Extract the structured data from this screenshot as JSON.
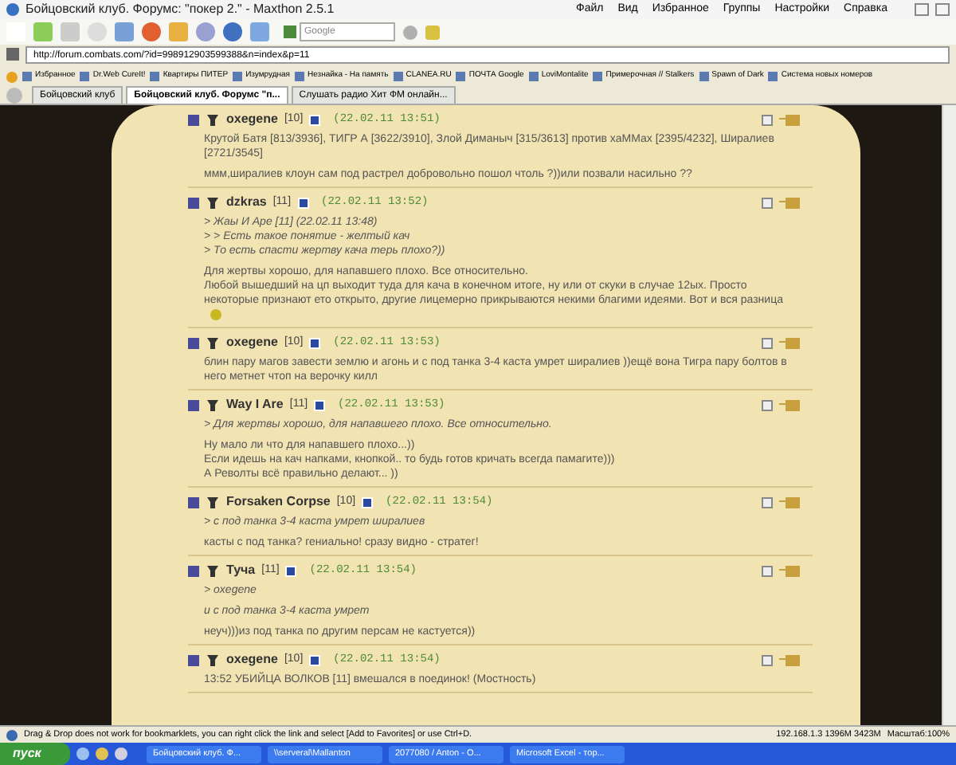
{
  "window": {
    "title": "Бойцовский клуб. Форумс: \"покер 2.\" - Maxthon 2.5.1"
  },
  "menu": [
    "Файл",
    "Вид",
    "Избранное",
    "Группы",
    "Настройки",
    "Справка"
  ],
  "search": {
    "placeholder": "Google"
  },
  "address": {
    "value": "http://forum.combats.com/?id=998912903599388&n=index&p=11"
  },
  "bookmarks": [
    "Избранное",
    "Dr.Web CureIt!",
    "Квартиры ПИТЕР",
    "Изумрудная",
    "Незнайка - На память",
    "CLANEA.RU",
    "ПОЧТА Google",
    "LoviMontalite",
    "Примерочная // Stalkers",
    "Spawn of Dark",
    "Система  новых номеров"
  ],
  "tabs": [
    {
      "label": "Бойцовский клуб",
      "selected": false
    },
    {
      "label": "Бойцовский клуб. Форумс \"п...",
      "selected": true
    },
    {
      "label": "Слушать радио Хит ФМ онлайн...",
      "selected": false
    }
  ],
  "posts": [
    {
      "author": "oxegene",
      "level": "[10]",
      "time": "(22.02.11 13:51)",
      "checked": false,
      "paragraphs": [
        {
          "kind": "text",
          "text": "Крутой Батя [813/3936], ТИГР А [3622/3910], Злой Диманыч [315/3613] против хаММах [2395/4232], Ширалиев [2721/3545]"
        },
        {
          "kind": "text",
          "text": "ммм,ширалиев клоун сам под растрел добровольно пошол чтоль ?))или позвали насильно ??"
        }
      ]
    },
    {
      "author": "dzkras",
      "level": "[11]",
      "time": "(22.02.11 13:52)",
      "checked": false,
      "paragraphs": [
        {
          "kind": "quote",
          "text": "> Жаы И Аре [11] (22.02.11 13:48)\n> > Есть такое понятие - желтый кач\n> То есть спасти жертву кача терь плохо?))"
        },
        {
          "kind": "text",
          "text": "Для жертвы хорошо, для напавшего плохо. Все относительно.\nЛюбой вышедший на цп выходит туда для кача в конечном итоге, ну или от скуки в случае 12ых. Просто некоторые признают ето открыто, другие лицемерно прикрываются некими благими идеями. Вот и вся разница",
          "emoticon": true
        }
      ]
    },
    {
      "author": "oxegene",
      "level": "[10]",
      "time": "(22.02.11 13:53)",
      "checked": false,
      "paragraphs": [
        {
          "kind": "text",
          "text": "блин пару магов завести землю и агонь и с под танка 3-4 каста умрет ширалиев ))ещё вона Тигра пару болтов в него метнет чтоп на верочку килл"
        }
      ]
    },
    {
      "author": "Way I Are",
      "level": "[11]",
      "time": "(22.02.11 13:53)",
      "checked": false,
      "paragraphs": [
        {
          "kind": "quote",
          "text": "> Для жертвы хорошо, для напавшего плохо. Все относительно."
        },
        {
          "kind": "text",
          "text": "Ну мало ли что для напавшего плохо...))\nЕсли идешь на кач напками, кнопкой.. то будь готов кричать всегда памагите)))\nА Револты всё правильно делают... ))"
        }
      ]
    },
    {
      "author": "Forsaken Corpse",
      "level": "[10]",
      "time": "(22.02.11 13:54)",
      "checked": false,
      "paragraphs": [
        {
          "kind": "quote",
          "text": "> с под танка 3-4 каста умрет ширалиев"
        },
        {
          "kind": "text",
          "text": "касты с под танка? гениально! сразу видно - стратег!"
        }
      ]
    },
    {
      "author": "Туча",
      "level": "[11]",
      "time": "(22.02.11 13:54)",
      "checked": false,
      "paragraphs": [
        {
          "kind": "quote",
          "text": "> oxegene"
        },
        {
          "kind": "quote",
          "text": "и с под танка 3-4 каста умрет"
        },
        {
          "kind": "text",
          "text": "неуч)))из под танка по другим персам не кастуется))"
        }
      ]
    },
    {
      "author": "oxegene",
      "level": "[10]",
      "time": "(22.02.11 13:54)",
      "checked": false,
      "paragraphs": [
        {
          "kind": "text",
          "text": "13:52 УБИЙЦА ВОЛКОВ [11] вмешался в поединок! (Мостность)"
        }
      ]
    }
  ],
  "status_bar": {
    "text": "Drag & Drop does not work for bookmarklets, you can right click the link and select [Add to Favorites] or use Ctrl+D.",
    "memory": "192.168.1.3 1396M 3423M",
    "zoom": "Масштаб:100%"
  },
  "taskbar": {
    "start": "пуск",
    "tasks": [
      "Бойцовский клуб. Ф...",
      "\\\\serveral\\Mallanton",
      "2077080 / Anton - O...",
      "Microsoft Excel - тор..."
    ]
  }
}
